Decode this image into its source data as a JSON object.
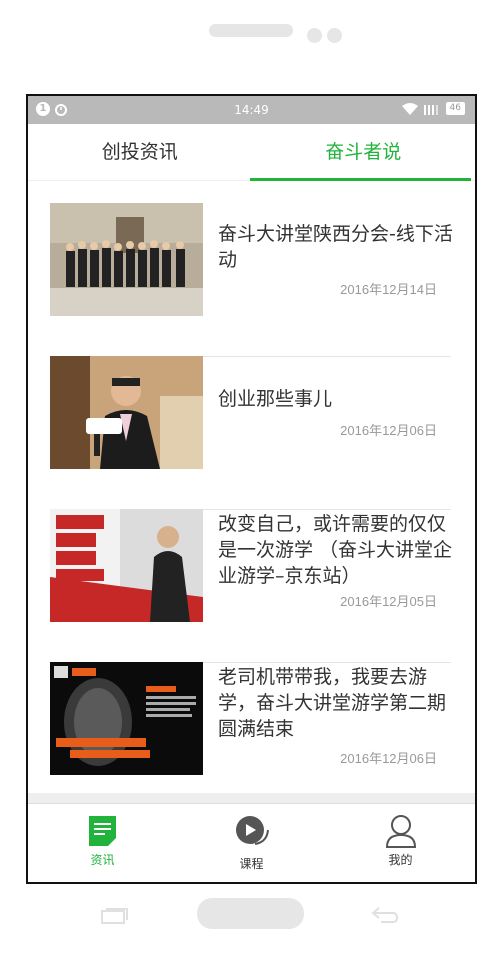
{
  "status": {
    "time": "14:49",
    "notif": "1",
    "battery": "46"
  },
  "tabs": [
    {
      "label": "创投资讯"
    },
    {
      "label": "奋斗者说"
    }
  ],
  "articles": [
    {
      "title": "奋斗大讲堂陕西分会-线下活动",
      "date": "2016年12月14日"
    },
    {
      "title": "创业那些事儿",
      "date": "2016年12月06日"
    },
    {
      "title": "改变自己，或许需要的仅仅是一次游学 （奋斗大讲堂企业游学–京东站）",
      "date": "2016年12月05日"
    },
    {
      "title": "老司机带带我，我要去游学，奋斗大讲堂游学第二期圆满结束",
      "date": "2016年12月06日"
    }
  ],
  "nav": [
    {
      "label": "资讯",
      "icon": "news-icon"
    },
    {
      "label": "课程",
      "icon": "chat-icon"
    },
    {
      "label": "我的",
      "icon": "user-icon"
    }
  ],
  "colors": {
    "accent": "#22b33c",
    "statusbar": "#b9b9b9"
  }
}
